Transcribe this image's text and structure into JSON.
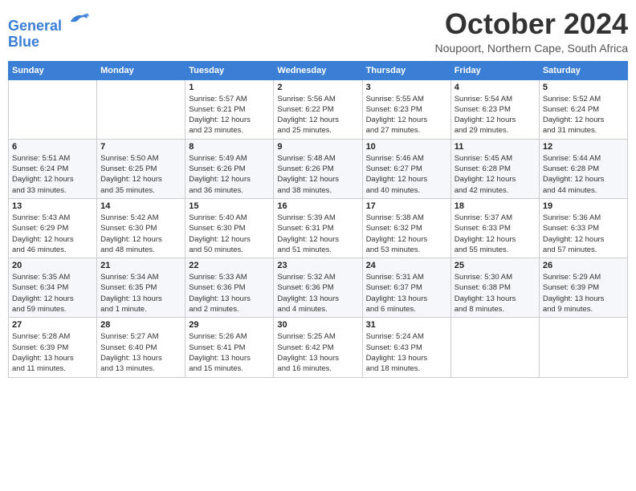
{
  "header": {
    "logo_line1": "General",
    "logo_line2": "Blue",
    "month": "October 2024",
    "location": "Noupoort, Northern Cape, South Africa"
  },
  "weekdays": [
    "Sunday",
    "Monday",
    "Tuesday",
    "Wednesday",
    "Thursday",
    "Friday",
    "Saturday"
  ],
  "weeks": [
    [
      {
        "day": "",
        "detail": ""
      },
      {
        "day": "",
        "detail": ""
      },
      {
        "day": "1",
        "detail": "Sunrise: 5:57 AM\nSunset: 6:21 PM\nDaylight: 12 hours\nand 23 minutes."
      },
      {
        "day": "2",
        "detail": "Sunrise: 5:56 AM\nSunset: 6:22 PM\nDaylight: 12 hours\nand 25 minutes."
      },
      {
        "day": "3",
        "detail": "Sunrise: 5:55 AM\nSunset: 6:23 PM\nDaylight: 12 hours\nand 27 minutes."
      },
      {
        "day": "4",
        "detail": "Sunrise: 5:54 AM\nSunset: 6:23 PM\nDaylight: 12 hours\nand 29 minutes."
      },
      {
        "day": "5",
        "detail": "Sunrise: 5:52 AM\nSunset: 6:24 PM\nDaylight: 12 hours\nand 31 minutes."
      }
    ],
    [
      {
        "day": "6",
        "detail": "Sunrise: 5:51 AM\nSunset: 6:24 PM\nDaylight: 12 hours\nand 33 minutes."
      },
      {
        "day": "7",
        "detail": "Sunrise: 5:50 AM\nSunset: 6:25 PM\nDaylight: 12 hours\nand 35 minutes."
      },
      {
        "day": "8",
        "detail": "Sunrise: 5:49 AM\nSunset: 6:26 PM\nDaylight: 12 hours\nand 36 minutes."
      },
      {
        "day": "9",
        "detail": "Sunrise: 5:48 AM\nSunset: 6:26 PM\nDaylight: 12 hours\nand 38 minutes."
      },
      {
        "day": "10",
        "detail": "Sunrise: 5:46 AM\nSunset: 6:27 PM\nDaylight: 12 hours\nand 40 minutes."
      },
      {
        "day": "11",
        "detail": "Sunrise: 5:45 AM\nSunset: 6:28 PM\nDaylight: 12 hours\nand 42 minutes."
      },
      {
        "day": "12",
        "detail": "Sunrise: 5:44 AM\nSunset: 6:28 PM\nDaylight: 12 hours\nand 44 minutes."
      }
    ],
    [
      {
        "day": "13",
        "detail": "Sunrise: 5:43 AM\nSunset: 6:29 PM\nDaylight: 12 hours\nand 46 minutes."
      },
      {
        "day": "14",
        "detail": "Sunrise: 5:42 AM\nSunset: 6:30 PM\nDaylight: 12 hours\nand 48 minutes."
      },
      {
        "day": "15",
        "detail": "Sunrise: 5:40 AM\nSunset: 6:30 PM\nDaylight: 12 hours\nand 50 minutes."
      },
      {
        "day": "16",
        "detail": "Sunrise: 5:39 AM\nSunset: 6:31 PM\nDaylight: 12 hours\nand 51 minutes."
      },
      {
        "day": "17",
        "detail": "Sunrise: 5:38 AM\nSunset: 6:32 PM\nDaylight: 12 hours\nand 53 minutes."
      },
      {
        "day": "18",
        "detail": "Sunrise: 5:37 AM\nSunset: 6:33 PM\nDaylight: 12 hours\nand 55 minutes."
      },
      {
        "day": "19",
        "detail": "Sunrise: 5:36 AM\nSunset: 6:33 PM\nDaylight: 12 hours\nand 57 minutes."
      }
    ],
    [
      {
        "day": "20",
        "detail": "Sunrise: 5:35 AM\nSunset: 6:34 PM\nDaylight: 12 hours\nand 59 minutes."
      },
      {
        "day": "21",
        "detail": "Sunrise: 5:34 AM\nSunset: 6:35 PM\nDaylight: 13 hours\nand 1 minute."
      },
      {
        "day": "22",
        "detail": "Sunrise: 5:33 AM\nSunset: 6:36 PM\nDaylight: 13 hours\nand 2 minutes."
      },
      {
        "day": "23",
        "detail": "Sunrise: 5:32 AM\nSunset: 6:36 PM\nDaylight: 13 hours\nand 4 minutes."
      },
      {
        "day": "24",
        "detail": "Sunrise: 5:31 AM\nSunset: 6:37 PM\nDaylight: 13 hours\nand 6 minutes."
      },
      {
        "day": "25",
        "detail": "Sunrise: 5:30 AM\nSunset: 6:38 PM\nDaylight: 13 hours\nand 8 minutes."
      },
      {
        "day": "26",
        "detail": "Sunrise: 5:29 AM\nSunset: 6:39 PM\nDaylight: 13 hours\nand 9 minutes."
      }
    ],
    [
      {
        "day": "27",
        "detail": "Sunrise: 5:28 AM\nSunset: 6:39 PM\nDaylight: 13 hours\nand 11 minutes."
      },
      {
        "day": "28",
        "detail": "Sunrise: 5:27 AM\nSunset: 6:40 PM\nDaylight: 13 hours\nand 13 minutes."
      },
      {
        "day": "29",
        "detail": "Sunrise: 5:26 AM\nSunset: 6:41 PM\nDaylight: 13 hours\nand 15 minutes."
      },
      {
        "day": "30",
        "detail": "Sunrise: 5:25 AM\nSunset: 6:42 PM\nDaylight: 13 hours\nand 16 minutes."
      },
      {
        "day": "31",
        "detail": "Sunrise: 5:24 AM\nSunset: 6:43 PM\nDaylight: 13 hours\nand 18 minutes."
      },
      {
        "day": "",
        "detail": ""
      },
      {
        "day": "",
        "detail": ""
      }
    ]
  ]
}
